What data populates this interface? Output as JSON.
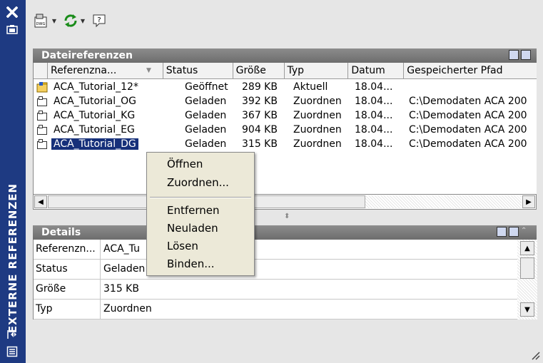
{
  "window": {
    "title": "EXTERNE REFERENZEN",
    "icons": {
      "close": "close-icon",
      "pin": "autohide-icon",
      "properties": "properties-icon",
      "expand": "expand-icon"
    }
  },
  "toolbar": {
    "items": [
      {
        "icon": "attach-dwg-icon",
        "dropdown": true
      },
      {
        "icon": "refresh-icon",
        "dropdown": true
      },
      {
        "icon": "help-icon",
        "dropdown": false
      }
    ]
  },
  "file_references": {
    "title": "Dateireferenzen",
    "columns": [
      "Referenzna...",
      "Status",
      "Größe",
      "Typ",
      "Datum",
      "Gespeicherter Pfad"
    ],
    "rows": [
      {
        "icon": "drawing-open-icon",
        "name": "ACA_Tutorial_12*",
        "status": "Geöffnet",
        "size": "289 KB",
        "type": "Aktuell",
        "date": "18.04...",
        "path": ""
      },
      {
        "icon": "xref-icon",
        "name": "ACA_Tutorial_OG",
        "status": "Geladen",
        "size": "392 KB",
        "type": "Zuordnen",
        "date": "18.04...",
        "path": "C:\\Demodaten ACA 200"
      },
      {
        "icon": "xref-icon",
        "name": "ACA_Tutorial_KG",
        "status": "Geladen",
        "size": "367 KB",
        "type": "Zuordnen",
        "date": "18.04...",
        "path": "C:\\Demodaten ACA 200"
      },
      {
        "icon": "xref-icon",
        "name": "ACA_Tutorial_EG",
        "status": "Geladen",
        "size": "904 KB",
        "type": "Zuordnen",
        "date": "18.04...",
        "path": "C:\\Demodaten ACA 200"
      },
      {
        "icon": "xref-icon",
        "name": "ACA_Tutorial_DG",
        "status": "Geladen",
        "size": "315 KB",
        "type": "Zuordnen",
        "date": "18.04...",
        "path": "C:\\Demodaten ACA 200",
        "selected": true
      }
    ]
  },
  "details": {
    "title": "Details",
    "rows": [
      {
        "key": "Referenzn...",
        "value": "ACA_Tu"
      },
      {
        "key": "Status",
        "value": "Geladen"
      },
      {
        "key": "Größe",
        "value": "315 KB"
      },
      {
        "key": "Typ",
        "value": "Zuordnen"
      }
    ]
  },
  "context_menu": {
    "items": [
      "Öffnen",
      "Zuordnen...",
      "Entfernen",
      "Neuladen",
      "Lösen",
      "Binden..."
    ]
  },
  "colors": {
    "title_bar": "#1e3a82",
    "selection": "#16307a",
    "section_header": "#7a7a7a",
    "menu_background": "#ece9d8"
  }
}
